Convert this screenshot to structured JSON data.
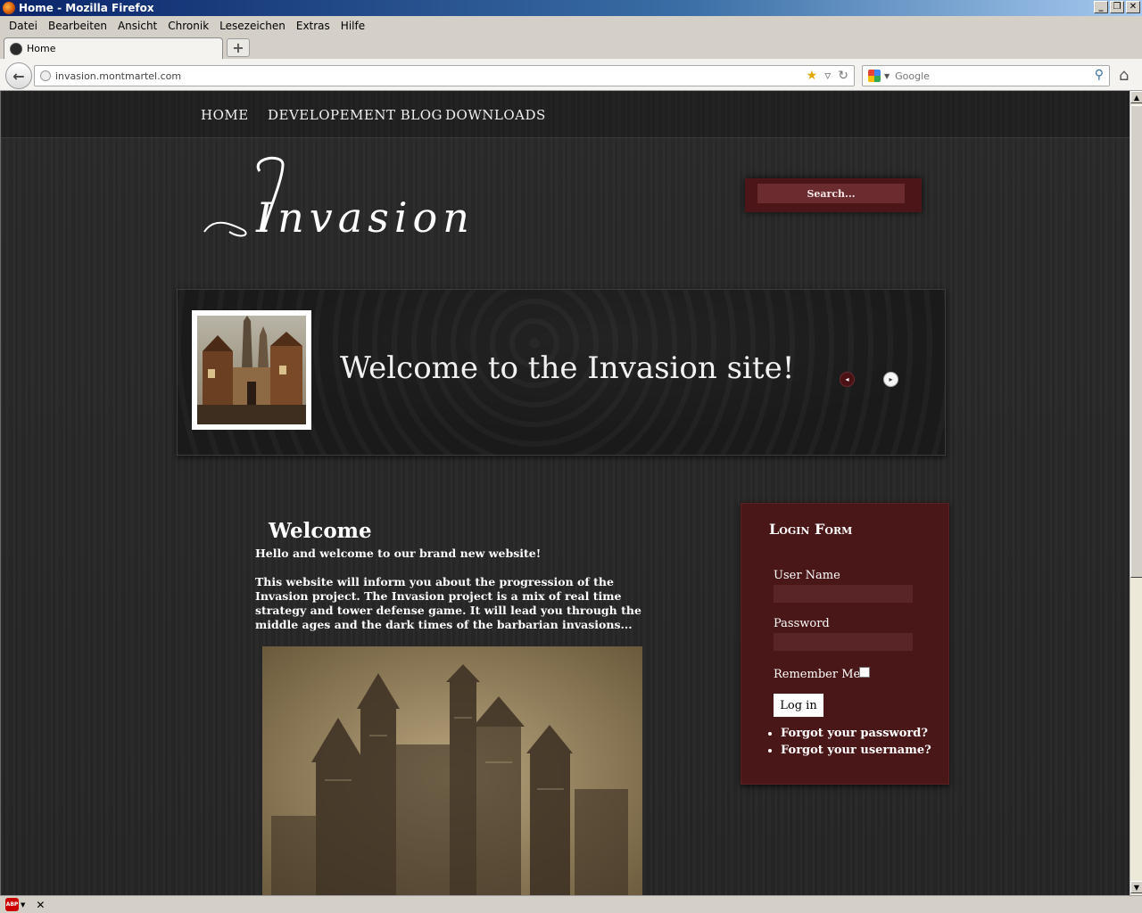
{
  "window": {
    "title": "Home - Mozilla Firefox",
    "controls": [
      "_",
      "❐",
      "✕"
    ]
  },
  "menu": [
    "Datei",
    "Bearbeiten",
    "Ansicht",
    "Chronik",
    "Lesezeichen",
    "Extras",
    "Hilfe"
  ],
  "tabs": [
    {
      "label": "Home",
      "active": true
    }
  ],
  "new_tab_label": "+",
  "navigation": {
    "url": "invasion.montmartel.com",
    "search_engine": "Google",
    "search_placeholder": "Google"
  },
  "site": {
    "nav": [
      "HOME",
      "DEVELOPEMENT BLOG",
      "DOWNLOADS"
    ],
    "logo_text": "Invasion",
    "search_placeholder": "Search...",
    "banner": {
      "title": "Welcome to the Invasion site!",
      "prev_icon": "◂",
      "next_icon": "▸"
    },
    "article": {
      "heading": "Welcome",
      "intro": "Hello and welcome to our brand new website!",
      "body": "This website will inform you about the progression of the Invasion project. The Invasion project is a mix of real time strategy and tower defense game. It will lead you through the middle ages and the dark times of the barbarian invasions..."
    },
    "login": {
      "title": "Login Form",
      "username_label": "User Name",
      "password_label": "Password",
      "remember_label": "Remember Me",
      "submit_label": "Log in",
      "links": [
        "Forgot your password?",
        "Forgot your username?"
      ]
    }
  },
  "statusbar": {
    "addon": "ABP",
    "close": "✕"
  },
  "colors": {
    "page_bg": "#2a2a2a",
    "accent_red": "#4a1718",
    "titlebar": "#0a246a"
  }
}
